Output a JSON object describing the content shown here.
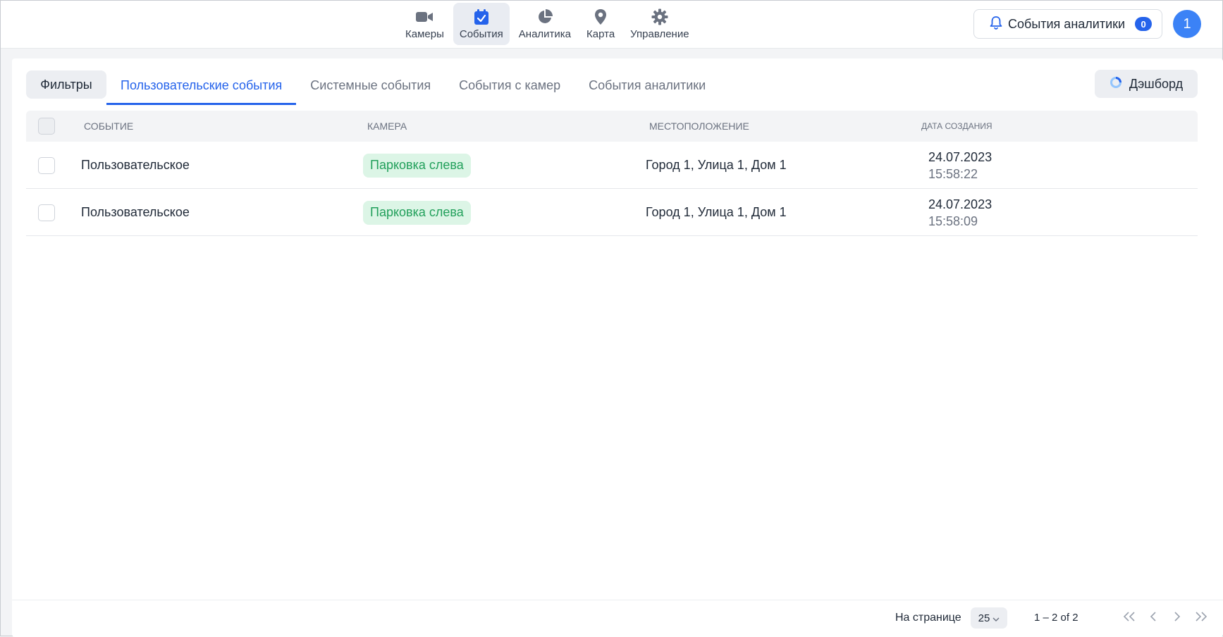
{
  "nav": {
    "items": [
      {
        "label": "Камеры",
        "icon": "video-camera-icon"
      },
      {
        "label": "События",
        "icon": "calendar-check-icon",
        "active": true
      },
      {
        "label": "Аналитика",
        "icon": "pie-chart-icon"
      },
      {
        "label": "Карта",
        "icon": "map-pin-icon"
      },
      {
        "label": "Управление",
        "icon": "gear-icon"
      }
    ]
  },
  "header": {
    "analytics_events_label": "События аналитики",
    "analytics_events_count": "0",
    "avatar_initial": "1"
  },
  "toolbar": {
    "filters_label": "Фильтры",
    "dashboard_label": "Дэшборд",
    "tabs": [
      {
        "label": "Пользовательские события",
        "active": true
      },
      {
        "label": "Системные события"
      },
      {
        "label": "События с камер"
      },
      {
        "label": "События аналитики"
      }
    ]
  },
  "table": {
    "columns": [
      "Событие",
      "Камера",
      "Местоположение",
      "Дата создания"
    ],
    "rows": [
      {
        "event": "Пользовательское",
        "camera": "Парковка слева",
        "location": "Город 1, Улица 1, Дом 1",
        "date": "24.07.2023",
        "time": "15:58:22"
      },
      {
        "event": "Пользовательское",
        "camera": "Парковка слева",
        "location": "Город 1, Улица 1, Дом 1",
        "date": "24.07.2023",
        "time": "15:58:09"
      }
    ]
  },
  "pagination": {
    "per_page_label": "На странице",
    "per_page_value": "25",
    "range_label": "1 – 2 of 2"
  },
  "colors": {
    "accent": "#2563eb",
    "camera_tag_bg": "#dcf5e6",
    "camera_tag_text": "#22a05b"
  }
}
